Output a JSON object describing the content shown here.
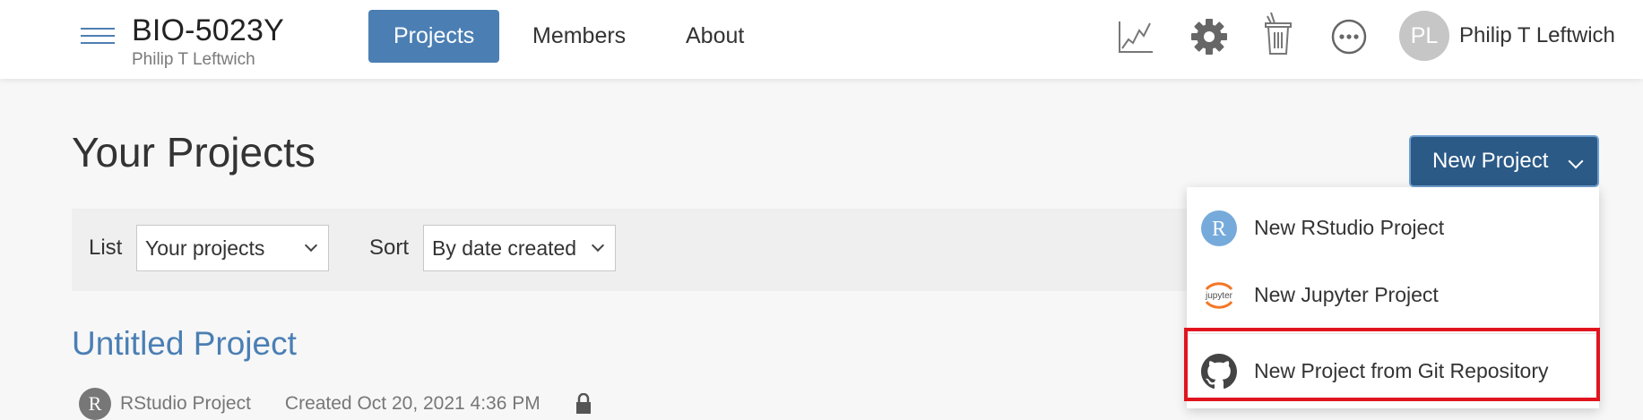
{
  "header": {
    "space_title": "BIO-5023Y",
    "space_owner": "Philip T Leftwich",
    "nav": [
      {
        "label": "Projects",
        "active": true
      },
      {
        "label": "Members",
        "active": false
      },
      {
        "label": "About",
        "active": false
      }
    ],
    "icons": [
      "analytics-icon",
      "settings-icon",
      "trash-icon",
      "more-icon"
    ],
    "user": {
      "initials": "PL",
      "name": "Philip T Leftwich"
    }
  },
  "main": {
    "title": "Your Projects",
    "new_project_label": "New Project",
    "filters": {
      "list_label": "List",
      "list_value": "Your projects",
      "sort_label": "Sort",
      "sort_value": "By date created"
    },
    "project": {
      "title": "Untitled Project",
      "type_initial": "R",
      "type": "RStudio Project",
      "created": "Created Oct 20, 2021 4:36 PM"
    }
  },
  "new_project_menu": {
    "items": [
      {
        "label": "New RStudio Project",
        "icon": "rstudio-icon"
      },
      {
        "label": "New Jupyter Project",
        "icon": "jupyter-icon"
      },
      {
        "label": "New Project from Git Repository",
        "icon": "github-icon"
      }
    ],
    "rstudio_icon_letter": "R",
    "jupyter_icon_text": "jupyter",
    "highlighted_item": "New Project from Git Repository"
  },
  "colors": {
    "accent": "#4b7fb4",
    "new_project_bg": "#2b5a87",
    "highlight_border": "#e0141e",
    "jupyter_orange": "#f37626"
  }
}
